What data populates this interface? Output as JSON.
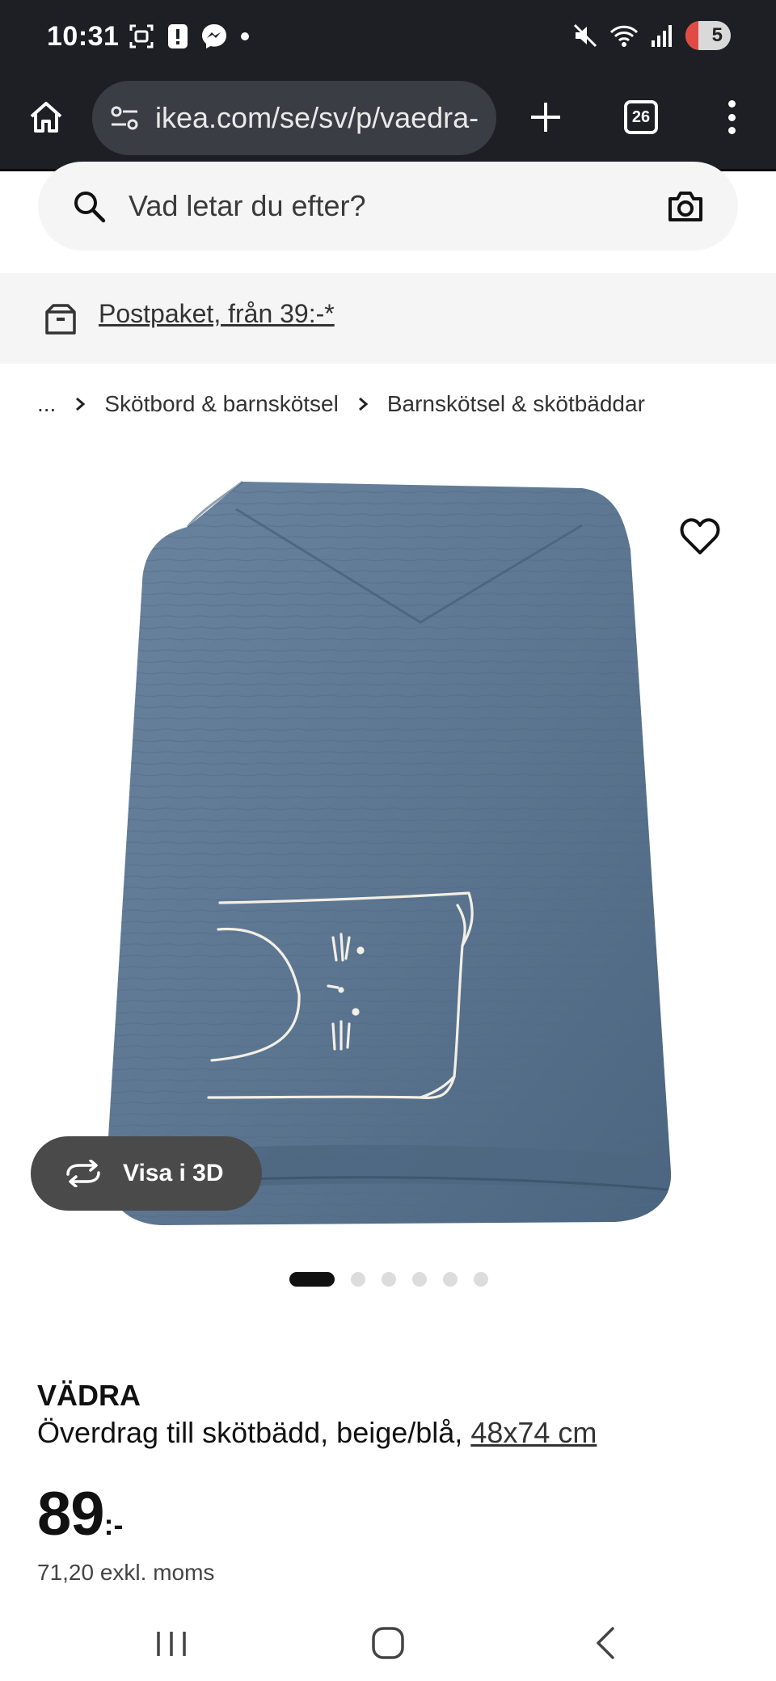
{
  "status_bar": {
    "time": "10:31",
    "battery_level": "5",
    "icons": [
      "screenshot-icon",
      "alert-icon",
      "messenger-icon",
      "notification-dot-icon",
      "mute-icon",
      "wifi-icon",
      "signal-icon",
      "battery-icon"
    ]
  },
  "browser": {
    "url": "ikea.com/se/sv/p/vaedra-",
    "tab_count": "26",
    "icons": [
      "home-icon",
      "site-settings-icon",
      "new-tab-icon",
      "tab-switcher-icon",
      "overflow-menu-icon"
    ]
  },
  "search": {
    "placeholder": "Vad letar du efter?",
    "icons": [
      "search-icon",
      "camera-icon"
    ]
  },
  "shipping_banner": {
    "text": "Postpaket, från 39:-*",
    "icon": "parcel-icon"
  },
  "breadcrumb": {
    "ellipsis": "...",
    "items": [
      "Skötbord & barnskötsel",
      "Barnskötsel & skötbäddar"
    ]
  },
  "gallery": {
    "view_3d_label": "Visa i 3D",
    "image_count": 6,
    "active_index": 0,
    "colors": {
      "fabric": "#5b7590",
      "embroidery": "#f3efe6"
    }
  },
  "product": {
    "name": "VÄDRA",
    "description": "Överdrag till skötbädd, beige/blå,",
    "size": "48x74 cm",
    "price": "89",
    "price_suffix": ":-",
    "price_excl_vat": "71,20 exkl. moms"
  },
  "colors": {
    "system_bar": "#1d1f24",
    "url_pill": "#3a3d44",
    "light_bg": "#f5f5f5",
    "button_3d": "#4a4a4a"
  }
}
